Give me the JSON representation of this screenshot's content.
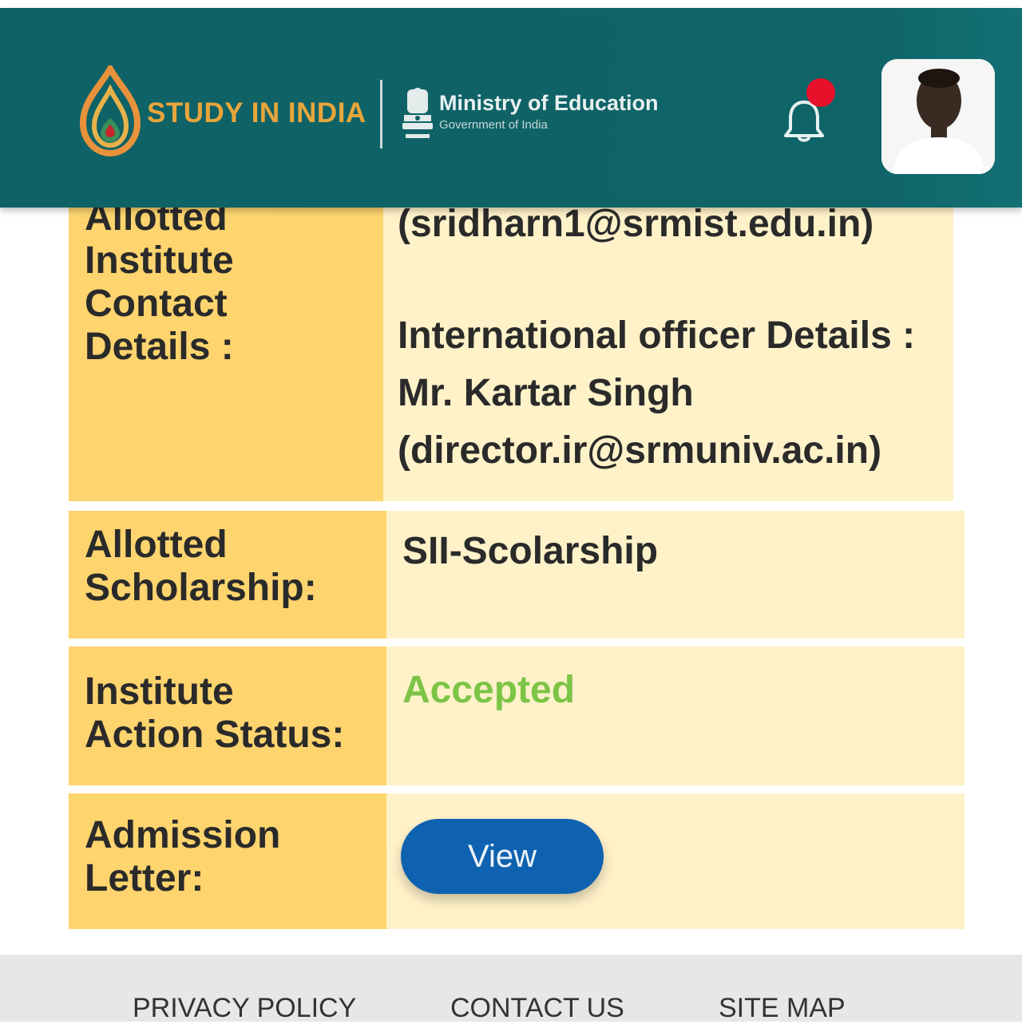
{
  "header": {
    "brand_name": "STUDY IN INDIA",
    "ministry_title": "Ministry of Education",
    "ministry_subtitle": "Government of India",
    "notification_dot_color": "#e8102a",
    "bar_color": "#0f6266"
  },
  "details": {
    "contact": {
      "label": "Allotted Institute Contact Details :",
      "label_lines": [
        "Allotted",
        "Institute",
        "Contact",
        "Details :"
      ],
      "value_email": "(sridharn1@srmist.edu.in)",
      "officer_heading": "International officer Details :",
      "officer_name": "Mr. Kartar Singh",
      "officer_email": "(director.ir@srmuniv.ac.in)"
    },
    "scholarship": {
      "label_lines": [
        "Allotted",
        "Scholarship:"
      ],
      "value": "SII-Scolarship"
    },
    "status": {
      "label_lines": [
        "Institute",
        "Action Status:"
      ],
      "value": "Accepted",
      "value_color": "#7cc446"
    },
    "admission": {
      "label_lines": [
        "Admission",
        "Letter:"
      ],
      "button_label": "View",
      "button_color": "#0f62b0"
    }
  },
  "footer": {
    "links": [
      "PRIVACY POLICY",
      "CONTACT US",
      "SITE MAP"
    ]
  }
}
